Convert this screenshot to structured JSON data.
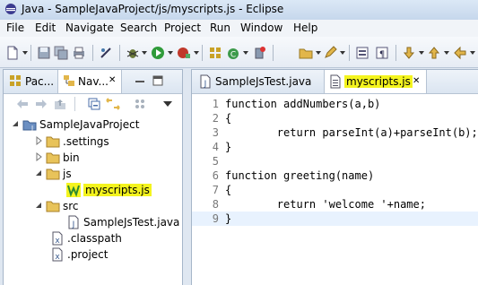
{
  "window": {
    "title": "Java - SampleJavaProject/js/myscripts.js - Eclipse"
  },
  "menu": [
    "File",
    "Edit",
    "Navigate",
    "Search",
    "Project",
    "Run",
    "Window",
    "Help"
  ],
  "nav": {
    "tabs": [
      {
        "label": "Pac..."
      },
      {
        "label": "Nav...",
        "close": "✕"
      }
    ],
    "tree": [
      {
        "label": "SampleJavaProject",
        "icon": "project-folder-icon",
        "expanded": true
      },
      {
        "label": ".settings",
        "icon": "folder-icon",
        "expanded": false
      },
      {
        "label": "bin",
        "icon": "folder-icon",
        "expanded": false
      },
      {
        "label": "js",
        "icon": "folder-icon",
        "expanded": true
      },
      {
        "label": "myscripts.js",
        "icon": "javascript-file-icon",
        "highlighted": true
      },
      {
        "label": "src",
        "icon": "folder-icon",
        "expanded": true
      },
      {
        "label": "SampleJsTest.java",
        "icon": "java-file-icon"
      },
      {
        "label": ".classpath",
        "icon": "xml-file-icon"
      },
      {
        "label": ".project",
        "icon": "xml-file-icon"
      }
    ]
  },
  "editor": {
    "tabs": [
      {
        "label": "SampleJsTest.java",
        "icon": "java-file-icon",
        "active": false
      },
      {
        "label": "myscripts.js",
        "icon": "text-file-icon",
        "active": true,
        "close": "✕"
      }
    ],
    "lines": [
      {
        "n": "1",
        "text": "function addNumbers(a,b)"
      },
      {
        "n": "2",
        "text": "{"
      },
      {
        "n": "3",
        "text": "        return parseInt(a)+parseInt(b);"
      },
      {
        "n": "4",
        "text": "}"
      },
      {
        "n": "5",
        "text": ""
      },
      {
        "n": "6",
        "text": "function greeting(name)"
      },
      {
        "n": "7",
        "text": "{"
      },
      {
        "n": "8",
        "text": "        return 'welcome '+name;"
      },
      {
        "n": "9",
        "text": "}",
        "current": true
      }
    ]
  },
  "colors": {
    "highlight": "#f4f41e",
    "current_line": "#e8f2fe"
  }
}
